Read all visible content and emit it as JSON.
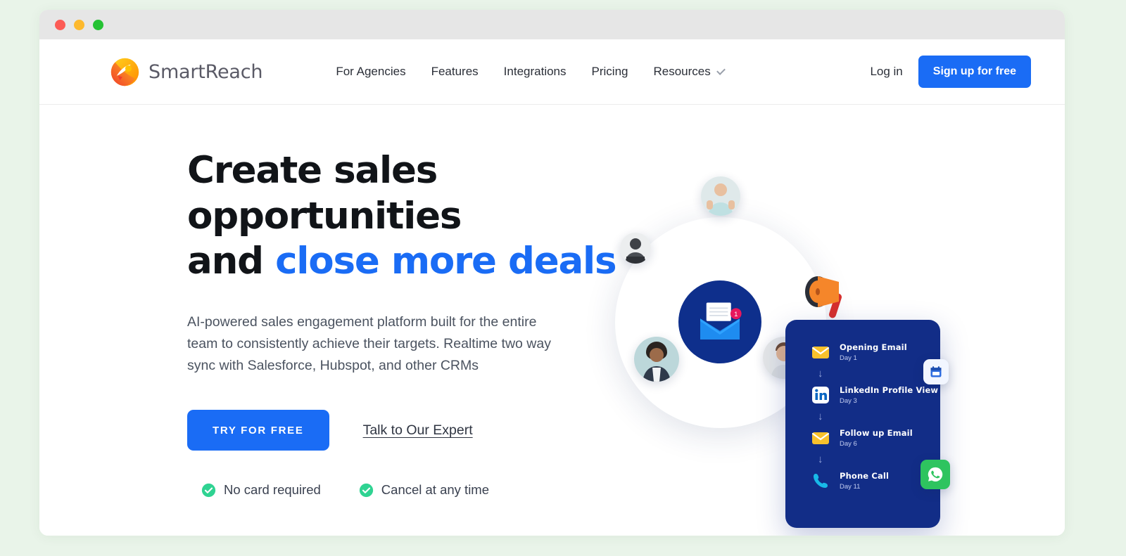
{
  "window": {
    "traffic_lights": [
      "close",
      "minimize",
      "maximize"
    ],
    "colors": {
      "close": "#fc5b55",
      "minimize": "#fdb92d",
      "maximize": "#25c233"
    }
  },
  "theme": {
    "page_background": "#e9f4e9",
    "primary_blue": "#1a6cf5",
    "deep_navy": "#122d87",
    "success_green": "#2ec45f",
    "accent_orange": "#f79420"
  },
  "header": {
    "brand": "SmartReach",
    "brand_icon": "smartreach-logo-icon",
    "nav": [
      {
        "label": "For Agencies",
        "has_dropdown": false
      },
      {
        "label": "Features",
        "has_dropdown": false
      },
      {
        "label": "Integrations",
        "has_dropdown": false
      },
      {
        "label": "Pricing",
        "has_dropdown": false
      },
      {
        "label": "Resources",
        "has_dropdown": true
      }
    ],
    "login_label": "Log in",
    "signup_label": "Sign up for free"
  },
  "hero": {
    "title_line1": "Create sales opportunities",
    "title_line2_plain": "and ",
    "title_line2_accent": "close more deals",
    "subtitle": "AI-powered sales engagement platform built for the entire team to consistently achieve their targets. Realtime two way sync with Salesforce, Hubspot, and other CRMs",
    "primary_cta": "TRY FOR FREE",
    "secondary_cta": "Talk to Our Expert",
    "assurances": [
      {
        "icon": "check-circle-icon",
        "label": "No card required"
      },
      {
        "icon": "check-circle-icon",
        "label": "Cancel at any time"
      }
    ]
  },
  "illustration": {
    "center_icon": "open-envelope-icon",
    "notification_count": "1",
    "floating_icons": [
      {
        "name": "megaphone-icon"
      },
      {
        "name": "calendar-icon"
      },
      {
        "name": "whatsapp-icon"
      }
    ],
    "avatars": [
      {
        "name": "avatar-person-thumbs-up"
      },
      {
        "name": "avatar-person-bearded"
      },
      {
        "name": "avatar-person-woman"
      },
      {
        "name": "avatar-person-man"
      }
    ],
    "sequence_card": {
      "steps": [
        {
          "icon": "email-icon",
          "title": "Opening Email",
          "day": "Day 1"
        },
        {
          "icon": "linkedin-icon",
          "title": "LinkedIn Profile View",
          "day": "Day 3"
        },
        {
          "icon": "email-icon",
          "title": "Follow up Email",
          "day": "Day 6"
        },
        {
          "icon": "phone-icon",
          "title": "Phone Call",
          "day": "Day 11"
        }
      ],
      "connector": "↓"
    }
  }
}
